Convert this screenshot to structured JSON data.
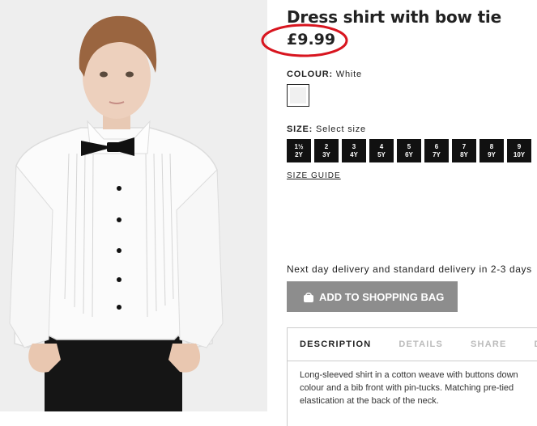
{
  "product": {
    "title": "Dress shirt with bow tie",
    "price": "£9.99",
    "image_alt": "Boy wearing white dress shirt with black bow tie"
  },
  "colour": {
    "label": "COLOUR:",
    "value": "White",
    "swatch_color": "#f0f0f0"
  },
  "size": {
    "label": "SIZE:",
    "value": "Select size",
    "options": [
      {
        "top": "1½",
        "bottom": "2Y"
      },
      {
        "top": "2",
        "bottom": "3Y"
      },
      {
        "top": "3",
        "bottom": "4Y"
      },
      {
        "top": "4",
        "bottom": "5Y"
      },
      {
        "top": "5",
        "bottom": "6Y"
      },
      {
        "top": "6",
        "bottom": "7Y"
      },
      {
        "top": "7",
        "bottom": "8Y"
      },
      {
        "top": "8",
        "bottom": "9Y"
      },
      {
        "top": "9",
        "bottom": "10Y"
      }
    ],
    "guide_label": "SIZE GUIDE"
  },
  "delivery": "Next day delivery and standard delivery in 2-3 days",
  "add_to_bag": {
    "label": "ADD TO SHOPPING BAG",
    "icon": "shopping-bag-icon"
  },
  "tabs": [
    {
      "label": "DESCRIPTION",
      "active": true
    },
    {
      "label": "DETAILS",
      "active": false
    },
    {
      "label": "SHARE",
      "active": false
    },
    {
      "label": "DE",
      "active": false
    }
  ],
  "description": {
    "line1": "Long-sleeved shirt in a cotton weave with buttons down",
    "line2": "colour and a bib front with pin-tucks. Matching pre-tied",
    "line3": "elastication at the back of the neck."
  },
  "colors": {
    "price_highlight": "#d8151f",
    "button_disabled": "#8d8d8d",
    "size_button": "#111111"
  }
}
